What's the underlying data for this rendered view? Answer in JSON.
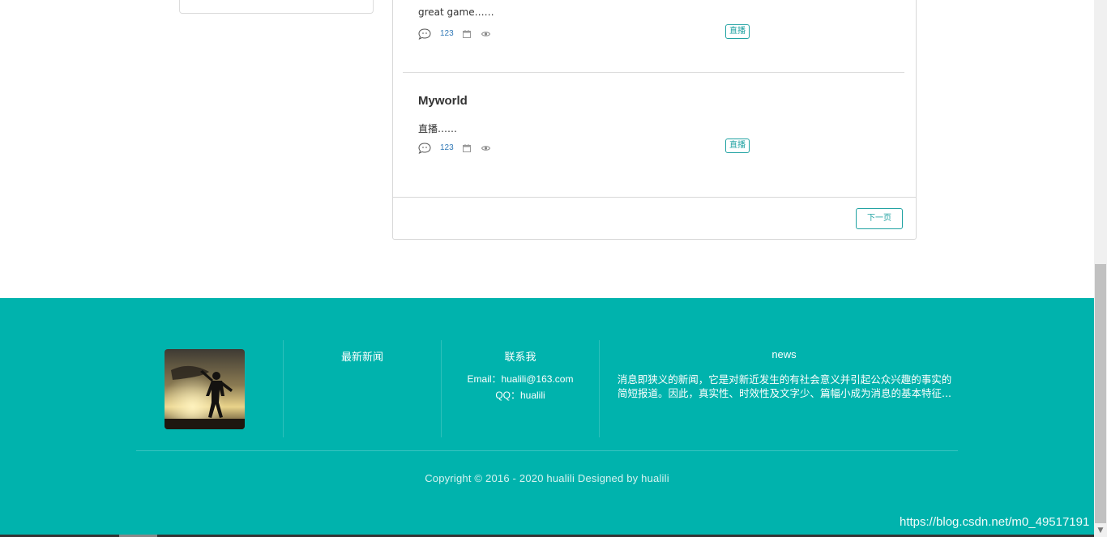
{
  "articles": [
    {
      "title": "",
      "summary": "great game……",
      "comment_count": "123",
      "tag": "直播"
    },
    {
      "title": "Myworld",
      "summary": "直播……",
      "comment_count": "123",
      "tag": "直播"
    }
  ],
  "pagination": {
    "next_label": "下一页"
  },
  "footer": {
    "col_news_title": "最新新闻",
    "col_contact_title": "联系我",
    "contact_email": "Email：hualili@163.com",
    "contact_qq": "QQ：hualili",
    "col_about_title": "news",
    "about_text": "消息即狭义的新闻，它是对新近发生的有社会意义并引起公众兴趣的事实的简短报道。因此，真实性、时效性及文字少、篇幅小成为消息的基本特征...",
    "copyright": "Copyright © 2016 - 2020 hualili Designed by hualili"
  },
  "watermark": "https://blog.csdn.net/m0_49517191",
  "colors": {
    "accent": "#00b3ad",
    "link": "#337ab7",
    "tag": "#20a2a2"
  }
}
